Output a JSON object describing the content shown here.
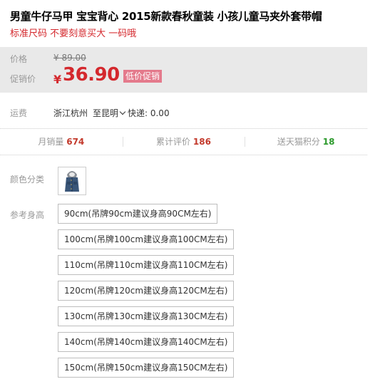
{
  "product": {
    "title": "男童牛仔马甲 宝宝背心 2015新款春秋童装 小孩儿童马夹外套带帽",
    "subtitle": "标准尺码 不要刻意买大 一码哦"
  },
  "price": {
    "label": "价格",
    "original": "¥ 89.00",
    "promo_label": "促销价",
    "currency": "¥",
    "promo_value": "36.90",
    "promo_badge": "低价促销"
  },
  "shipping": {
    "label": "运费",
    "from": "浙江杭州",
    "to": "至昆明",
    "fee": "快递: 0.00"
  },
  "stats": {
    "monthly_sales_label": "月销量",
    "monthly_sales": "674",
    "reviews_label": "累计评价",
    "reviews": "186",
    "points_label": "送天猫积分",
    "points": "18"
  },
  "color": {
    "label": "颜色分类",
    "swatch_icon": "denim-vest-thumbnail"
  },
  "size": {
    "label": "参考身高",
    "options": [
      "90cm(吊牌90cm建议身高90CM左右)",
      "100cm(吊牌100cm建议身高100CM左右)",
      "110cm(吊牌110cm建议身高110CM左右)",
      "120cm(吊牌120cm建议身高120CM左右)",
      "130cm(吊牌130cm建议身高130CM左右)",
      "140cm(吊牌140cm建议身高140CM左右)",
      "150cm(吊牌150cm建议身高150CM左右)"
    ]
  },
  "colors": {
    "accent_red": "#d4282d",
    "badge_pink": "#e47a8c",
    "points_green": "#2c9a2c",
    "panel_gray": "#e9e9e9"
  }
}
